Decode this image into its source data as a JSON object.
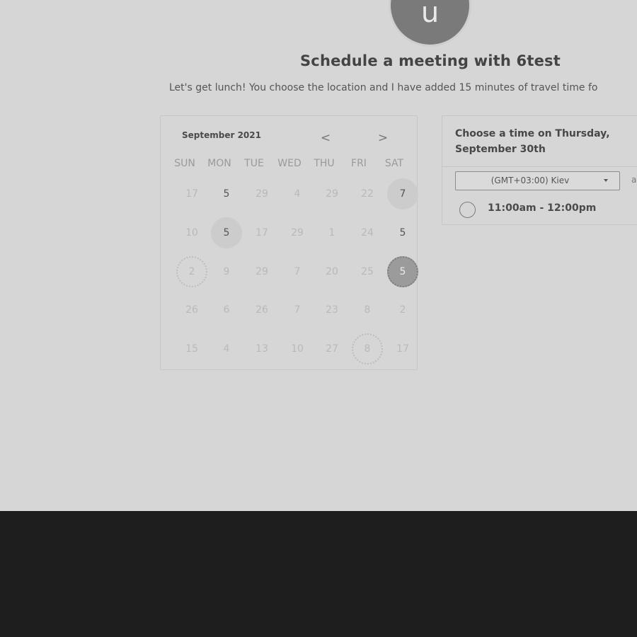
{
  "host": {
    "avatar_initial": "u",
    "title": "Schedule a meeting with 6test",
    "description": "Let's get lunch! You choose the location and I have added 15 minutes of travel time fo"
  },
  "calendar": {
    "month_label": "September 2021",
    "prev_icon": "<",
    "next_icon": ">",
    "weekdays": [
      "SUN",
      "MON",
      "TUE",
      "WED",
      "THU",
      "FRI",
      "SAT"
    ],
    "weeks": [
      [
        {
          "label": "17",
          "state": "disabled"
        },
        {
          "label": "5",
          "state": "available"
        },
        {
          "label": "29",
          "state": "disabled"
        },
        {
          "label": "4",
          "state": "disabled"
        },
        {
          "label": "29",
          "state": "disabled"
        },
        {
          "label": "22",
          "state": "disabled"
        },
        {
          "label": "7",
          "state": "highlighted"
        }
      ],
      [
        {
          "label": "10",
          "state": "disabled"
        },
        {
          "label": "5",
          "state": "highlighted"
        },
        {
          "label": "17",
          "state": "disabled"
        },
        {
          "label": "29",
          "state": "disabled"
        },
        {
          "label": "1",
          "state": "disabled"
        },
        {
          "label": "24",
          "state": "disabled"
        },
        {
          "label": "5",
          "state": "available"
        }
      ],
      [
        {
          "label": "2",
          "state": "today"
        },
        {
          "label": "9",
          "state": "disabled"
        },
        {
          "label": "29",
          "state": "disabled"
        },
        {
          "label": "7",
          "state": "disabled"
        },
        {
          "label": "20",
          "state": "disabled"
        },
        {
          "label": "25",
          "state": "disabled"
        },
        {
          "label": "5",
          "state": "selected"
        }
      ],
      [
        {
          "label": "26",
          "state": "disabled"
        },
        {
          "label": "6",
          "state": "disabled"
        },
        {
          "label": "26",
          "state": "disabled"
        },
        {
          "label": "7",
          "state": "disabled"
        },
        {
          "label": "23",
          "state": "disabled"
        },
        {
          "label": "8",
          "state": "disabled"
        },
        {
          "label": "2",
          "state": "disabled"
        }
      ],
      [
        {
          "label": "15",
          "state": "disabled"
        },
        {
          "label": "4",
          "state": "disabled"
        },
        {
          "label": "13",
          "state": "disabled"
        },
        {
          "label": "10",
          "state": "disabled"
        },
        {
          "label": "27",
          "state": "disabled"
        },
        {
          "label": "8",
          "state": "today"
        },
        {
          "label": "17",
          "state": "disabled"
        }
      ]
    ]
  },
  "times": {
    "heading": "Choose a time on Thursday, September 30th",
    "timezone": "(GMT+03:00) Kiev",
    "timezone_extra": "a",
    "slots": [
      {
        "label": "11:00am - 12:00pm",
        "selected": false
      }
    ]
  },
  "colors": {
    "page_background": "#d6d6d6",
    "footer_background": "#1e1e1e",
    "avatar": "#7a7a7a",
    "selected_day": "#9b9b9b"
  }
}
